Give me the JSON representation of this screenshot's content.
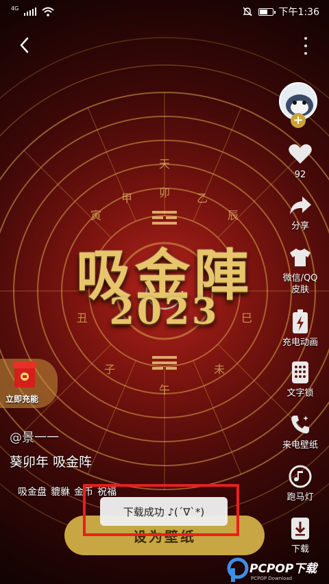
{
  "status_bar": {
    "network_type": "4G",
    "time": "下午1:36"
  },
  "nav": {
    "back_icon": "chevron-left-icon",
    "more_icon": "more-vertical-icon"
  },
  "wallpaper_art": {
    "title": "吸金陣",
    "year": "2023"
  },
  "sidebar": {
    "like_count": "92",
    "share_label": "分享",
    "skin_label": "微信/QQ\n皮肤",
    "charge_anim_label": "充电动画",
    "lock_label": "文字锁",
    "call_wallpaper_label": "来电壁纸",
    "marquee_label": "跑马灯",
    "download_label": "下载"
  },
  "promo": {
    "label": "立即充能"
  },
  "post": {
    "author": "@景一一",
    "description": "葵卯年 吸金阵",
    "tags": [
      "吸金盘",
      "貔貅",
      "金币",
      "祝福"
    ]
  },
  "set_wallpaper_button": "设为壁纸",
  "toast": "下载成功 ♪(´∇`*)",
  "colors": {
    "accent_gold": "#c8a643",
    "highlight_red": "#e8201b",
    "follow_badge": "#c9a33a"
  }
}
